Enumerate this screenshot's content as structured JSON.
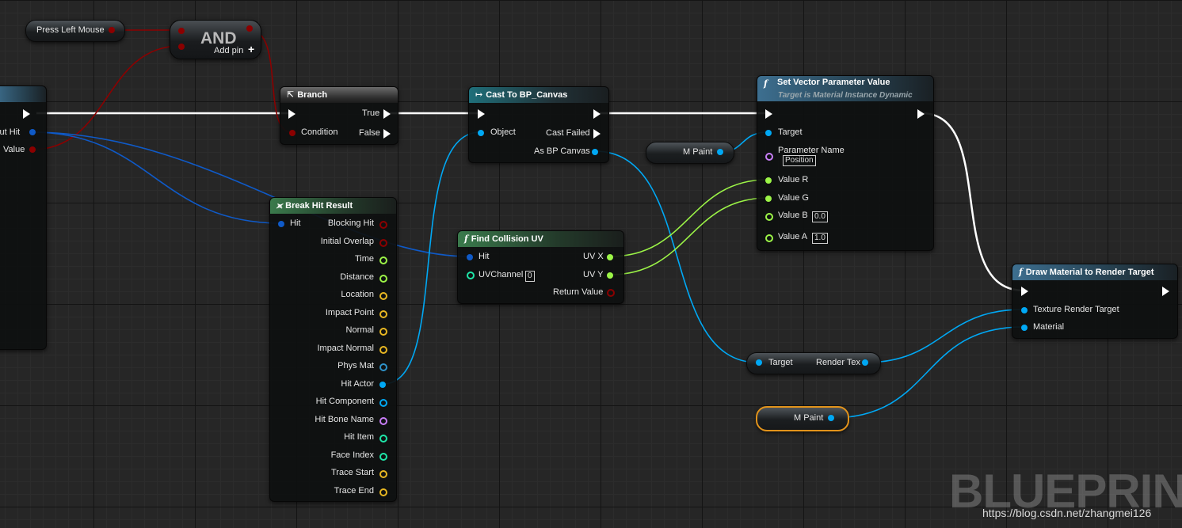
{
  "colors": {
    "exec": "#ffffff",
    "bool": "#8b0000",
    "struct": "#0f5ac8",
    "object": "#00a8f4",
    "float": "#9cf547",
    "vector": "#e8b722",
    "integer": "#1ee6a8",
    "name": "#c87ef7",
    "physmat": "#2f93c9",
    "selection": "#e2931b"
  },
  "press_left_mouse": {
    "label": "Press Left Mouse"
  },
  "and_node": {
    "title": "AND",
    "add_pin": "Add pin"
  },
  "left_node": {
    "out_hit": "Out Hit",
    "return_value": "Value"
  },
  "branch": {
    "title": "Branch",
    "true": "True",
    "false": "False",
    "condition": "Condition"
  },
  "cast": {
    "title": "Cast To BP_Canvas",
    "object": "Object",
    "cast_failed": "Cast Failed",
    "as_canvas": "As BP Canvas"
  },
  "set_vector": {
    "title": "Set Vector Parameter Value",
    "subtitle": "Target is Material Instance Dynamic",
    "target": "Target",
    "param_name": "Parameter Name",
    "param_value": "Position",
    "value_r": "Value R",
    "value_g": "Value G",
    "value_b": "Value B",
    "value_b_default": "0.0",
    "value_a": "Value A",
    "value_a_default": "1.0"
  },
  "m_paint_top": {
    "label": "M Paint"
  },
  "break_hit": {
    "title": "Break Hit Result",
    "hit": "Hit",
    "pins": [
      "Blocking Hit",
      "Initial Overlap",
      "Time",
      "Distance",
      "Location",
      "Impact Point",
      "Normal",
      "Impact Normal",
      "Phys Mat",
      "Hit Actor",
      "Hit Component",
      "Hit Bone Name",
      "Hit Item",
      "Face Index",
      "Trace Start",
      "Trace End"
    ]
  },
  "find_uv": {
    "title": "Find Collision UV",
    "hit": "Hit",
    "uv_channel": "UVChannel",
    "uv_channel_default": "0",
    "uv_x": "UV X",
    "uv_y": "UV Y",
    "return_value": "Return Value"
  },
  "draw_material": {
    "title": "Draw Material to Render Target",
    "texture": "Texture Render Target",
    "material": "Material"
  },
  "render_tex": {
    "target": "Target",
    "render_tex": "Render Tex"
  },
  "m_paint_bottom": {
    "label": "M Paint"
  },
  "watermark": {
    "text": "BLUEPRINT",
    "credit": "https://blog.csdn.net/zhangmei126"
  }
}
